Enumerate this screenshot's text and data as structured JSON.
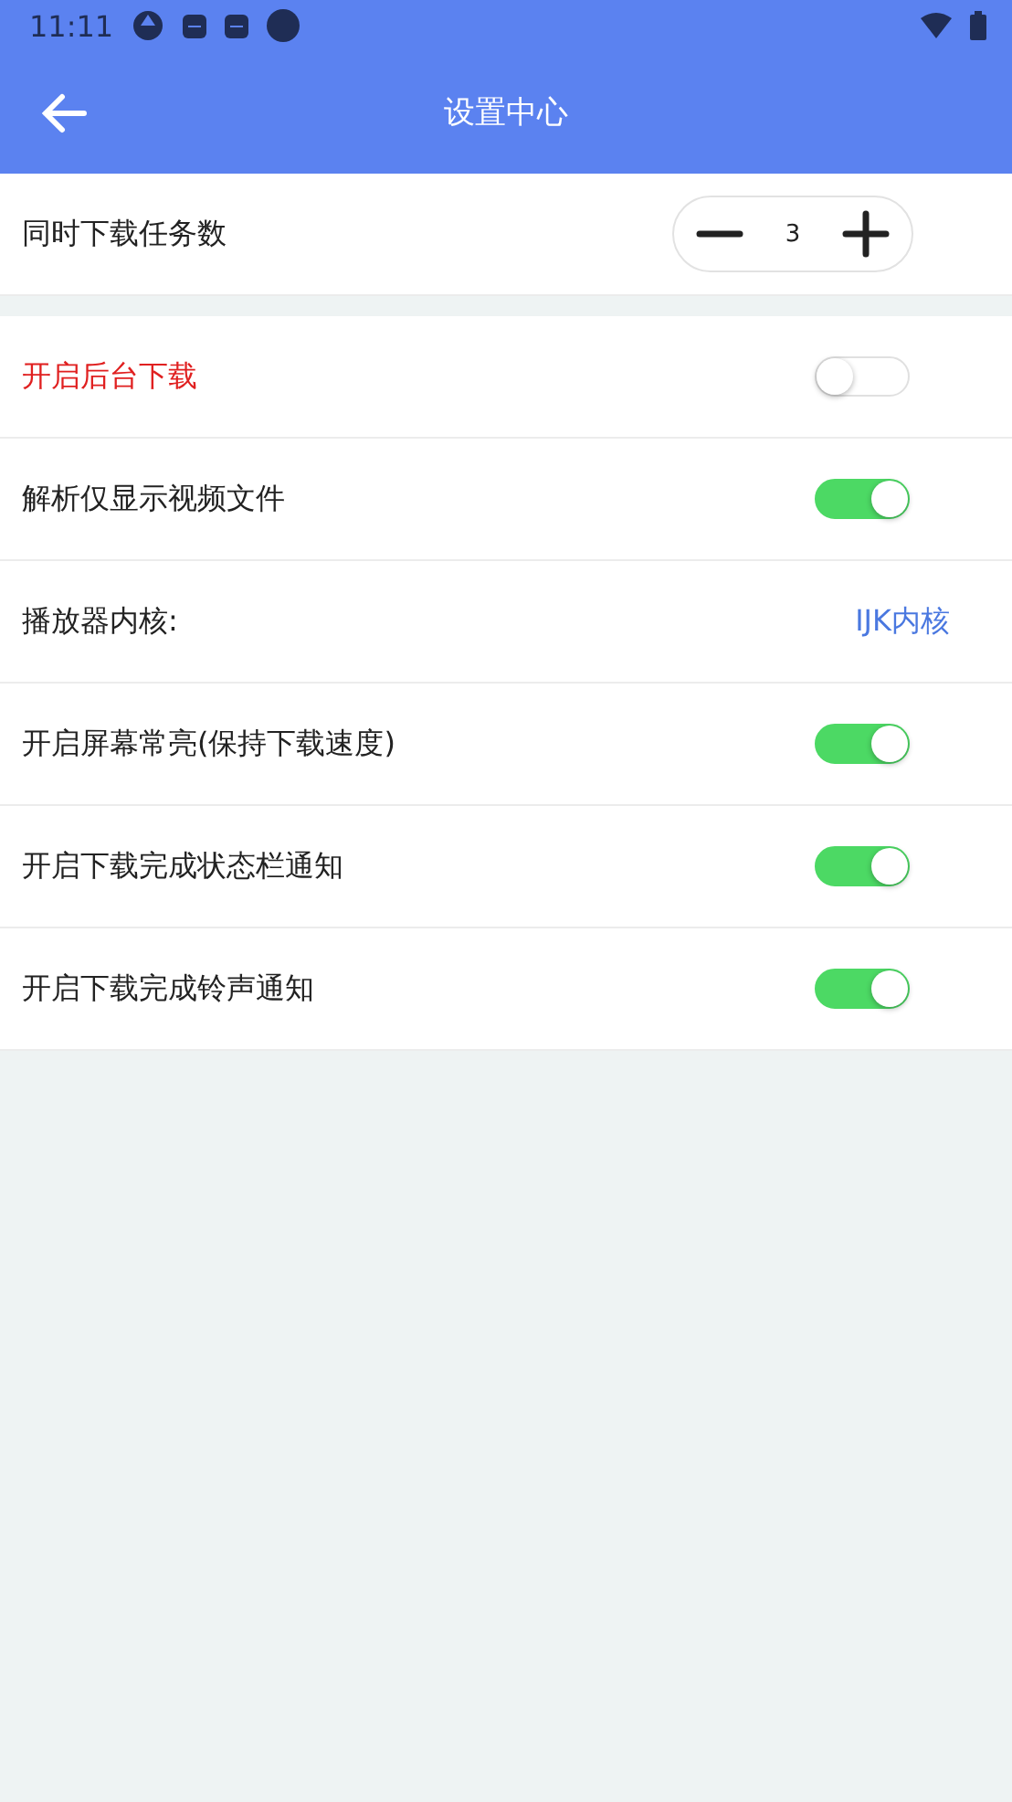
{
  "status_bar": {
    "time": "11:11"
  },
  "header": {
    "title": "设置中心"
  },
  "stepper": {
    "label": "同时下载任务数",
    "value": "3"
  },
  "settings": [
    {
      "kind": "toggle",
      "label": "开启后台下载",
      "emphasis": true,
      "on": false
    },
    {
      "kind": "toggle",
      "label": "解析仅显示视频文件",
      "emphasis": false,
      "on": true
    },
    {
      "kind": "link",
      "label": "播放器内核:",
      "emphasis": false,
      "value": "IJK内核"
    },
    {
      "kind": "toggle",
      "label": "开启屏幕常亮(保持下载速度)",
      "emphasis": false,
      "on": true
    },
    {
      "kind": "toggle",
      "label": "开启下载完成状态栏通知",
      "emphasis": false,
      "on": true
    },
    {
      "kind": "toggle",
      "label": "开启下载完成铃声通知",
      "emphasis": false,
      "on": true
    }
  ]
}
